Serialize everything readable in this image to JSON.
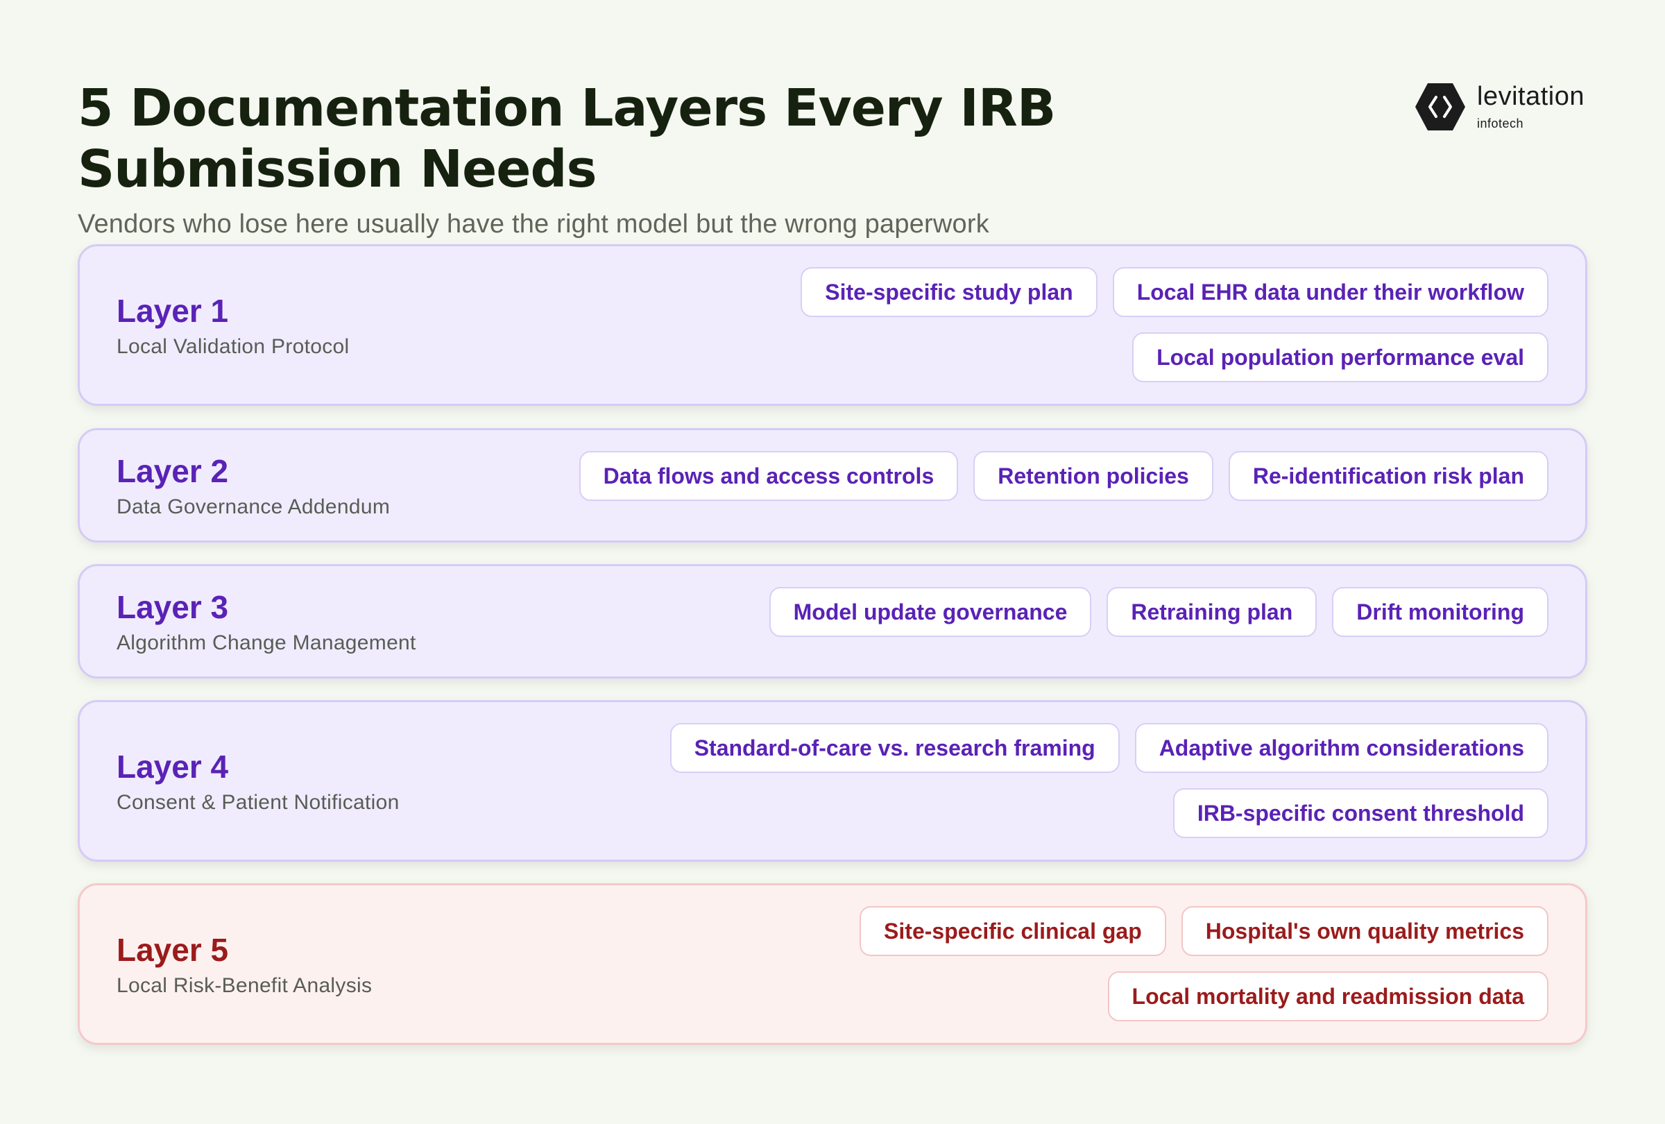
{
  "header": {
    "title": "5 Documentation Layers Every IRB Submission Needs",
    "subtitle": "Vendors who lose here usually have the right model but the wrong paperwork"
  },
  "logo": {
    "name": "levitation",
    "sub": "infotech"
  },
  "colors": {
    "background": "#f5f7f1",
    "layer_fill": "#f0ecfe",
    "layer_border": "#d5cbf5",
    "layer_accent": "#5a22b5",
    "danger_fill": "#fdf1f0",
    "danger_border": "#f5c9c9",
    "danger_accent": "#9b1b1b"
  },
  "layers": [
    {
      "name": "Layer 1",
      "description": "Local Validation Protocol",
      "chip_rows": [
        [
          "Site-specific study plan",
          "Local EHR data under their workflow"
        ],
        [
          "Local population performance eval"
        ]
      ]
    },
    {
      "name": "Layer 2",
      "description": "Data Governance Addendum",
      "chip_rows": [
        [
          "Data flows and access controls",
          "Retention policies",
          "Re-identification risk plan"
        ]
      ]
    },
    {
      "name": "Layer 3",
      "description": "Algorithm Change Management",
      "chip_rows": [
        [
          "Model update governance",
          "Retraining plan",
          "Drift monitoring"
        ]
      ]
    },
    {
      "name": "Layer 4",
      "description": "Consent & Patient Notification",
      "chip_rows": [
        [
          "Standard-of-care vs. research framing",
          "Adaptive algorithm considerations"
        ],
        [
          "IRB-specific consent threshold"
        ]
      ]
    },
    {
      "name": "Layer 5",
      "description": "Local Risk-Benefit Analysis",
      "chip_rows": [
        [
          "Site-specific clinical gap",
          "Hospital's own quality metrics"
        ],
        [
          "Local mortality and readmission data"
        ]
      ]
    }
  ]
}
